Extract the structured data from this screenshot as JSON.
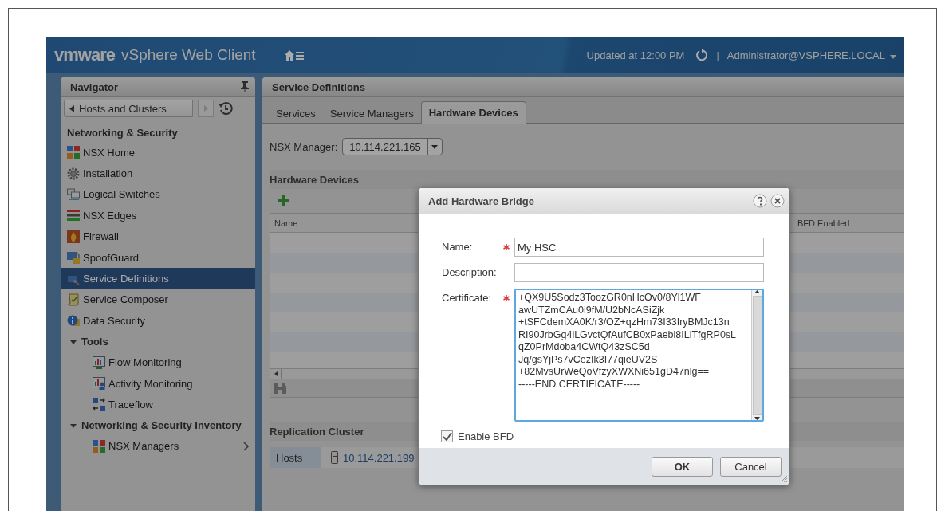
{
  "header": {
    "logo": "vmware",
    "product": "vSphere Web Client",
    "updated": "Updated at 12:00 PM",
    "separator": "|",
    "user": "Administrator@VSPHERE.LOCAL"
  },
  "navigator": {
    "title": "Navigator",
    "history": "Hosts and Clusters",
    "heading": "Networking & Security",
    "items": [
      {
        "label": "NSX Home",
        "selected": false
      },
      {
        "label": "Installation",
        "selected": false
      },
      {
        "label": "Logical Switches",
        "selected": false
      },
      {
        "label": "NSX Edges",
        "selected": false
      },
      {
        "label": "Firewall",
        "selected": false
      },
      {
        "label": "SpoofGuard",
        "selected": false
      },
      {
        "label": "Service Definitions",
        "selected": true
      },
      {
        "label": "Service Composer",
        "selected": false
      },
      {
        "label": "Data Security",
        "selected": false
      }
    ],
    "groups": [
      {
        "label": "Tools",
        "expanded": true,
        "children": [
          {
            "label": "Flow Monitoring",
            "selected": false
          },
          {
            "label": "Activity Monitoring",
            "selected": false
          },
          {
            "label": "Traceflow",
            "selected": false
          }
        ]
      },
      {
        "label": "Networking & Security Inventory",
        "expanded": true,
        "children": [
          {
            "label": "NSX Managers",
            "selected": false,
            "has_submenu": true
          }
        ]
      }
    ]
  },
  "content": {
    "title": "Service Definitions",
    "tabs": [
      {
        "label": "Services",
        "selected": false
      },
      {
        "label": "Service Managers",
        "selected": false
      },
      {
        "label": "Hardware Devices",
        "selected": true
      }
    ],
    "manager": {
      "label": "NSX Manager:",
      "value": "10.114.221.165"
    },
    "devices": {
      "title": "Hardware Devices",
      "columns": [
        "Name",
        "BFD Enabled"
      ]
    },
    "replication": {
      "title": "Replication Cluster",
      "label": "Hosts",
      "host": "10.114.221.199"
    }
  },
  "dialog": {
    "title": "Add Hardware Bridge",
    "fields": [
      {
        "label": "Name:",
        "required": true,
        "value": "My HSC"
      },
      {
        "label": "Description:",
        "required": false
      }
    ],
    "certificate": {
      "label": "Certificate:",
      "required": true,
      "lines": [
        "+QX9U5Sodz3ToozGR0nHcOv0/8Yl1WF",
        "awUTZmCAu0i9fM/U2bNcASiZjk",
        "+tSFCdemXA0K/r3/OZ+qzHm73I33IryBMJc13n",
        "RI90JrbGg4iLGvctQfAufCB0xPaebl8ILiTfgRP0sL",
        "qZ0PrMdoba4CWtQ43zSC5d",
        "Jq/gsYjPs7vCezIk3I77qieUV2S",
        "+82MvsUrWeQoVfzyXWXNi651gD47nlg==",
        "-----END CERTIFICATE-----"
      ]
    },
    "bfd": {
      "label": "Enable BFD",
      "checked": true
    },
    "buttons": [
      "OK",
      "Cancel"
    ]
  }
}
